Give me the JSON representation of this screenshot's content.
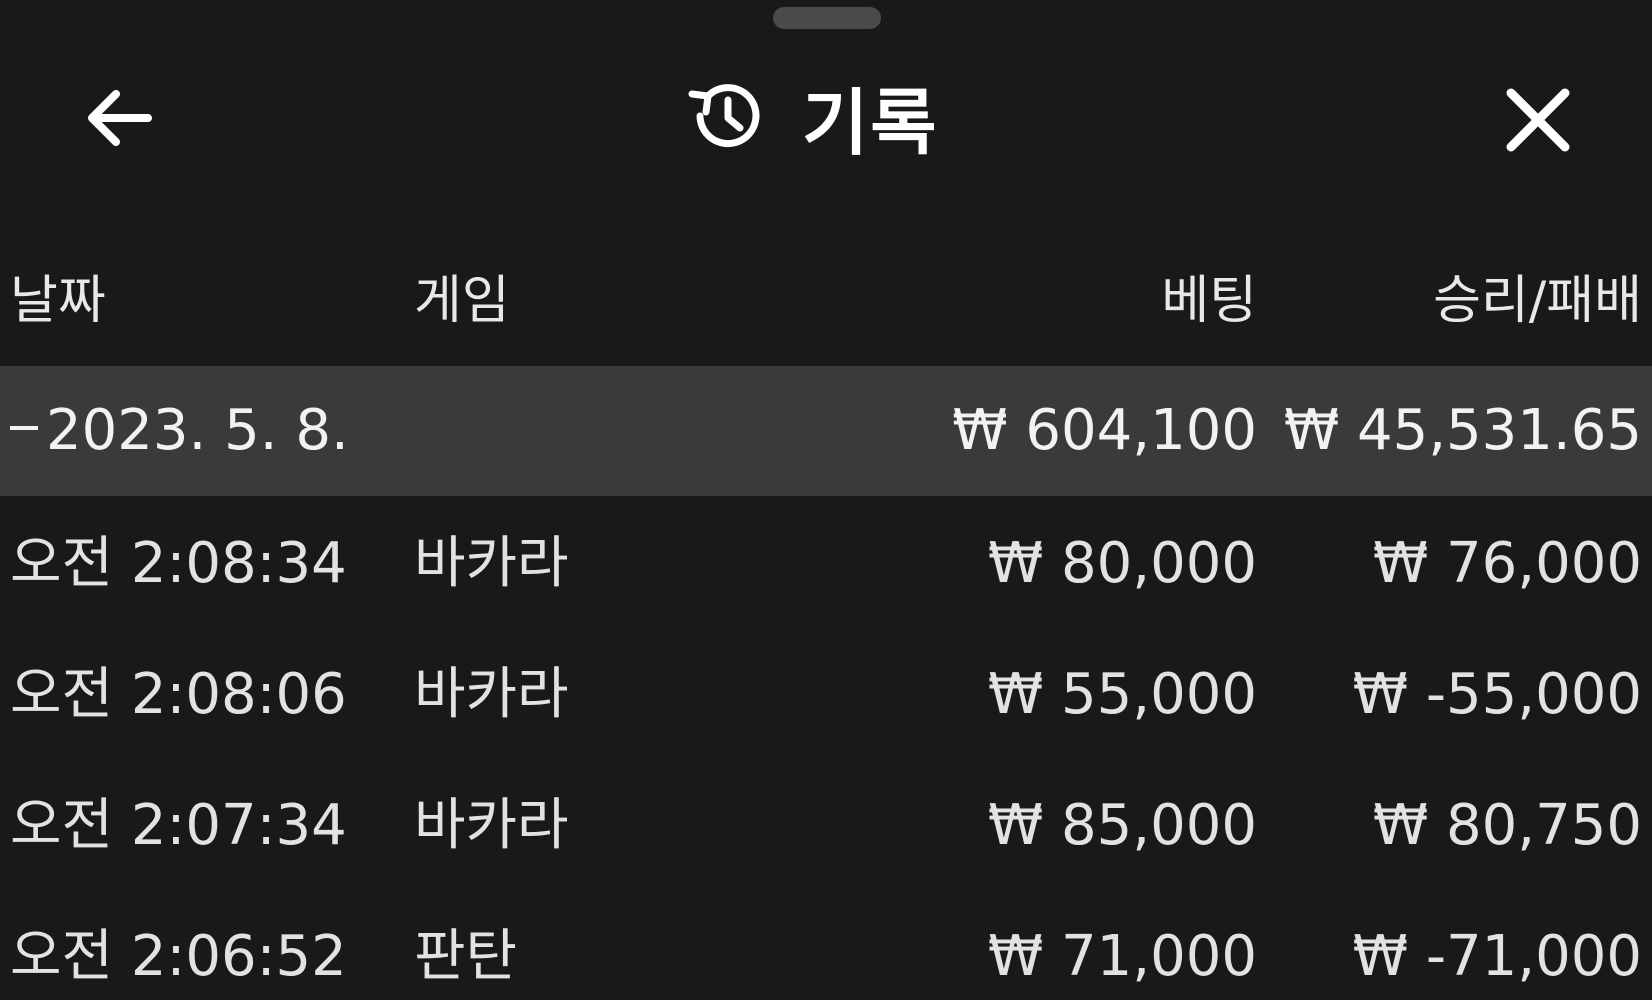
{
  "header": {
    "title": "기록",
    "back_icon": "arrow-left-icon",
    "history_icon": "history-clock-icon",
    "close_icon": "close-x-icon"
  },
  "table": {
    "columns": {
      "date": "날짜",
      "game": "게임",
      "bet": "베팅",
      "result": "승리/패배"
    },
    "group": {
      "date": "2023. 5. 8.",
      "bet": "₩ 604,100",
      "result": "₩ 45,531.65"
    },
    "rows": [
      {
        "time": "오전 2:08:34",
        "game": "바카라",
        "bet": "₩ 80,000",
        "result": "₩ 76,000"
      },
      {
        "time": "오전 2:08:06",
        "game": "바카라",
        "bet": "₩ 55,000",
        "result": "₩ -55,000"
      },
      {
        "time": "오전 2:07:34",
        "game": "바카라",
        "bet": "₩ 85,000",
        "result": "₩ 80,750"
      },
      {
        "time": "오전 2:06:52",
        "game": "판탄",
        "bet": "₩ 71,000",
        "result": "₩ -71,000"
      }
    ]
  },
  "colors": {
    "background": "#19191b",
    "group_row": "#3a3a3c",
    "text": "#e6e6e6"
  }
}
